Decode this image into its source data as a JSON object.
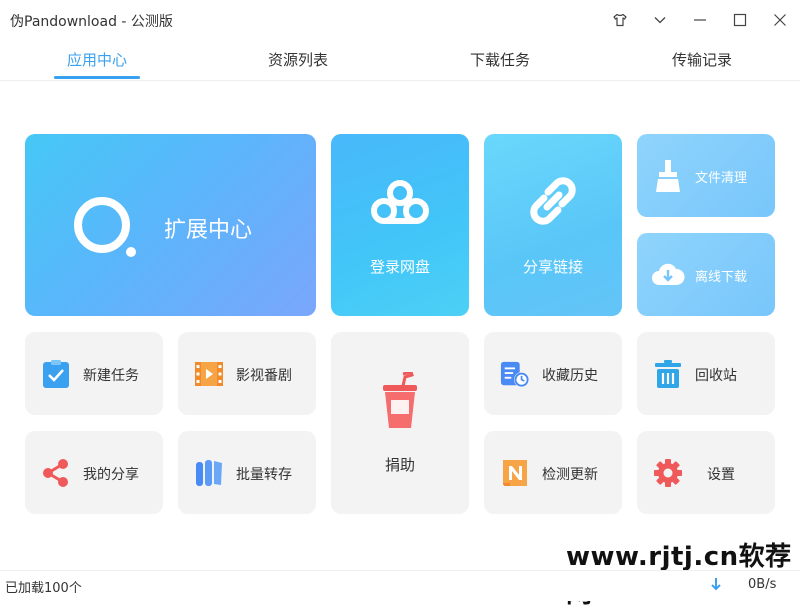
{
  "window": {
    "title": "伪Pandownload - 公测版"
  },
  "tabs": [
    {
      "label": "应用中心",
      "active": true
    },
    {
      "label": "资源列表",
      "active": false
    },
    {
      "label": "下载任务",
      "active": false
    },
    {
      "label": "传输记录",
      "active": false
    }
  ],
  "tiles": {
    "extension": "扩展中心",
    "login": "登录网盘",
    "share_link": "分享链接",
    "clean": "文件清理",
    "offline": "离线下载",
    "new_task": "新建任务",
    "video": "影视番剧",
    "donate": "捐助",
    "fav_history": "收藏历史",
    "recycle": "回收站",
    "my_share": "我的分享",
    "batch_save": "批量转存",
    "check_update": "检测更新",
    "settings": "设置"
  },
  "watermark": "www.rjtj.cn软荐网",
  "status": {
    "loaded": "已加载100个",
    "speed": "0B/s"
  },
  "colors": {
    "accent": "#3aa0f0",
    "tile_gray": "#f3f3f3"
  }
}
